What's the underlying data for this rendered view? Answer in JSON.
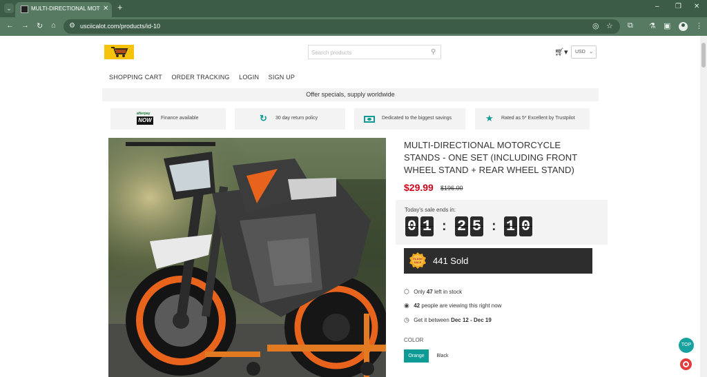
{
  "browser": {
    "tab_title": "MULTI-DIRECTIONAL MOTORCYCLE",
    "tab_close": "✕",
    "new_tab": "+",
    "url": "usciicalot.com/products/id-10",
    "window_controls": [
      "–",
      "❐",
      "✕"
    ]
  },
  "header": {
    "search_placeholder": "Search products",
    "currency": "USD"
  },
  "nav": {
    "items": [
      "SHOPPING CART",
      "ORDER TRACKING",
      "LOGIN",
      "SIGN UP"
    ]
  },
  "offer_banner": "Offer specials, supply worldwide",
  "features": [
    {
      "label": "Finance available",
      "icon": "afterpay-now-logo"
    },
    {
      "label": "30 day return policy",
      "icon": "refresh-icon"
    },
    {
      "label": "Dedicated to the biggest savings",
      "icon": "money-icon"
    },
    {
      "label": "Rated as 5* Excellent by Trustpilot",
      "icon": "star-icon"
    }
  ],
  "feature_badge": {
    "top": "afterpay",
    "main": "NOW"
  },
  "product": {
    "title": "MULTI-DIRECTIONAL MOTORCYCLE STANDS - ONE SET (INCLUDING FRONT WHEEL STAND + REAR WHEEL STAND)",
    "price": "$29.99",
    "old_price": "$196.00",
    "countdown_label": "Today's sale ends in:",
    "countdown": {
      "h1": "0",
      "h2": "1",
      "m1": "2",
      "m2": "5",
      "s1": "1",
      "s2": "0"
    },
    "separator": ":",
    "flash_badge": {
      "line1": "FLASH",
      "line2": "SALE"
    },
    "sold": "441 Sold",
    "stock": {
      "prefix": "Only",
      "value": "47",
      "suffix": "left in stock"
    },
    "viewers": {
      "value": "42",
      "suffix": "people are viewing this right now"
    },
    "delivery": {
      "prefix": "Get it between",
      "value": "Dec 12 - Dec 19"
    },
    "color_label": "COLOR",
    "colors": [
      "Orange",
      "Black"
    ],
    "selected_color": "Orange"
  },
  "floating": {
    "top_label": "TOP"
  },
  "colors": {
    "accent": "#0e9b96",
    "price": "#d0021b",
    "logo": "#f5c30b",
    "chrome": "#577a63"
  }
}
